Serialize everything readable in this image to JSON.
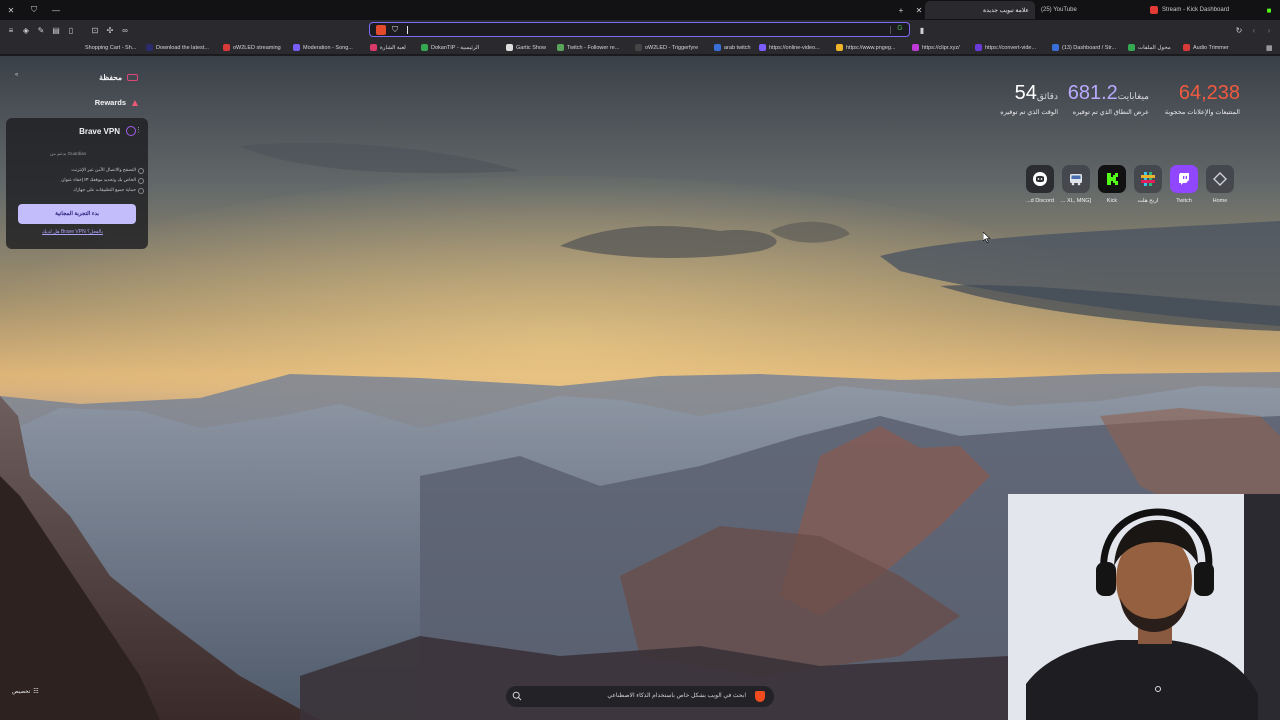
{
  "tabs": [
    {
      "label": "علامة تبويب جديدة",
      "active": true
    },
    {
      "label": "(25) YouTube",
      "active": false
    },
    {
      "label": "Stream - Kick Dashboard",
      "active": false
    }
  ],
  "bookmarks": [
    {
      "label": "Shopping Cart - Sh...",
      "color": "#3a6fd8"
    },
    {
      "label": "Download the latest...",
      "color": "#2b2b6e"
    },
    {
      "label": "oW2LED streaming",
      "color": "#d83a3a"
    },
    {
      "label": "Moderation - Song...",
      "color": "#7a5cff"
    },
    {
      "label": "لعبة الشارة",
      "color": "#d83a6a"
    },
    {
      "label": "DokanTIP - الرئيسية",
      "color": "#35a852"
    },
    {
      "label": "Gartic Show",
      "color": "#dddddd"
    },
    {
      "label": "Twitch - Follower re...",
      "color": "#5aa55a"
    },
    {
      "label": "oW2LED - Triggerfyre",
      "color": "#444444"
    },
    {
      "label": "arab twitch",
      "color": "#3a6fd8"
    },
    {
      "label": "https://online-video...",
      "color": "#7a5cff"
    },
    {
      "label": "https://www.pngeg...",
      "color": "#f0b429"
    },
    {
      "label": "https://clipr.xyz/",
      "color": "#c03ad8"
    },
    {
      "label": "https://convert-vide...",
      "color": "#6a3ad8"
    },
    {
      "label": "(13) Dashboard / Str...",
      "color": "#3a6fd8"
    },
    {
      "label": "محول الملفات",
      "color": "#35a852"
    },
    {
      "label": "Audio Trimmer",
      "color": "#d83a3a"
    }
  ],
  "stats": {
    "trackers": {
      "value": "64,238",
      "label": "المتتبعات والإعلانات محجوبة",
      "color": "#f15a3f"
    },
    "bandwidth": {
      "value": "681.2",
      "unit": "ميغابايت",
      "label": "عرض النطاق الذي تم توفيره",
      "color": "#b8a9ff"
    },
    "time": {
      "value": "54",
      "unit": "دقائق",
      "label": "الوقت الذي تم توفيره",
      "color": "#ffffff"
    }
  },
  "top_sites": [
    {
      "name": "Home",
      "icon": "diamond-icon"
    },
    {
      "name": "Twitch",
      "icon": "twitch-icon"
    },
    {
      "name": "اربح هلت",
      "icon": "hashtag-icon"
    },
    {
      "name": "Kick",
      "icon": "kick-icon"
    },
    {
      "name": "... XL, MNG]",
      "icon": "bus-icon"
    },
    {
      "name": "...d Discord",
      "icon": "discord-icon"
    }
  ],
  "widgets": {
    "wallet_label": "محفظة",
    "rewards_label": "Rewards",
    "vpn": {
      "title": "Brave VPN",
      "powered_by": "بدعم من Guardian",
      "features": [
        "التصفح والاتصال الآمن عبر الإنترنت",
        "إخفاء عنوان IP الخاص بك وتحديد موقعك",
        "حماية جميع التطبيقات على جهازك"
      ],
      "cta": "بدء التجربة المجانية",
      "link": "هل لديك Brave VPN بالفعل؟"
    }
  },
  "search": {
    "placeholder": "ابحث في الويب بشكل خاص باستخدام الذكاء الاصطناعي"
  },
  "customize_label": "تخصيص"
}
